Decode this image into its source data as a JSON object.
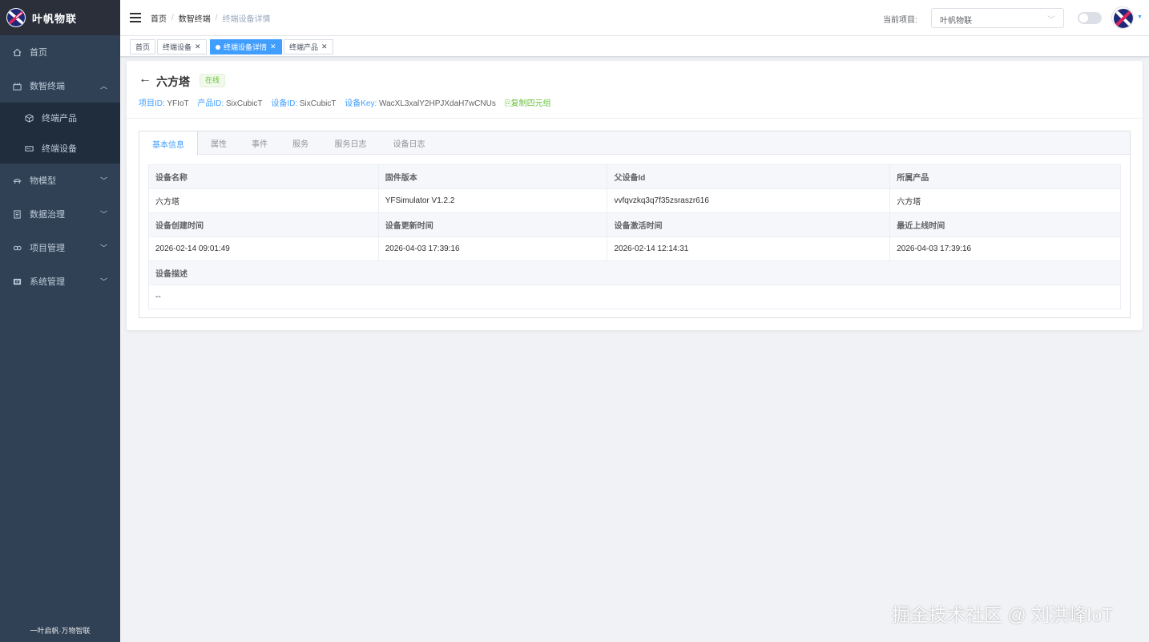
{
  "sidebar": {
    "brand": "叶帆物联",
    "items": [
      {
        "label": "首页",
        "icon": "home-icon"
      },
      {
        "label": "数智终端",
        "icon": "terminal-icon",
        "expanded": true,
        "children": [
          {
            "label": "终端产品",
            "icon": "cube-icon"
          },
          {
            "label": "终端设备",
            "icon": "device-icon"
          }
        ]
      },
      {
        "label": "物模型",
        "icon": "model-icon"
      },
      {
        "label": "数据治理",
        "icon": "data-icon"
      },
      {
        "label": "项目管理",
        "icon": "project-icon"
      },
      {
        "label": "系统管理",
        "icon": "system-icon"
      }
    ],
    "footer": "一叶启帆·万物智联"
  },
  "header": {
    "breadcrumb": [
      "首页",
      "数智终端",
      "终端设备详情"
    ],
    "project_label": "当前项目:",
    "project_value": "叶帆物联"
  },
  "tags": [
    {
      "label": "首页",
      "closable": false,
      "active": false
    },
    {
      "label": "终端设备",
      "closable": true,
      "active": false
    },
    {
      "label": "终端设备详情",
      "closable": true,
      "active": true
    },
    {
      "label": "终端产品",
      "closable": true,
      "active": false
    }
  ],
  "device": {
    "name": "六方塔",
    "status": "在线",
    "meta": {
      "project_id_key": "项目ID:",
      "project_id": "YFIoT",
      "product_id_key": "产品ID:",
      "product_id": "SixCubicT",
      "device_id_key": "设备ID:",
      "device_id": "SixCubicT",
      "device_key_key": "设备Key:",
      "device_key": "WacXL3xalY2HPJXdaH7wCNUs",
      "copy_label": "复制四元组"
    }
  },
  "tabs": [
    "基本信息",
    "属性",
    "事件",
    "服务",
    "服务日志",
    "设备日志"
  ],
  "info": {
    "row1_labels": [
      "设备名称",
      "固件版本",
      "父设备Id",
      "所属产品"
    ],
    "row1_values": [
      "六方塔",
      "YFSimulator V1.2.2",
      "vvfqvzkq3q7f35zsraszr616",
      "六方塔"
    ],
    "row2_labels": [
      "设备创建时间",
      "设备更新时间",
      "设备激活时间",
      "最近上线时间"
    ],
    "row2_values": [
      "2026-02-14 09:01:49",
      "2026-04-03 17:39:16",
      "2026-02-14 12:14:31",
      "2026-04-03 17:39:16"
    ],
    "desc_label": "设备描述",
    "desc_value": "--"
  },
  "watermark": "掘金技术社区 @ 刘洪峰IoT",
  "colors": {
    "sidebar_bg": "#304156",
    "submenu_bg": "#1f2d3d",
    "primary": "#409eff",
    "success": "#67c23a"
  }
}
